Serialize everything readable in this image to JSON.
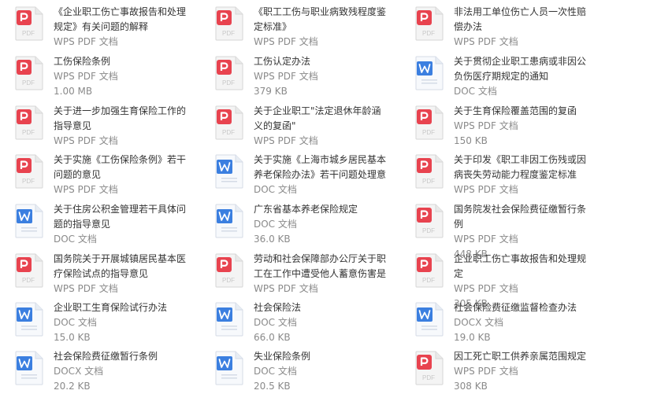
{
  "colors": {
    "pdf_red": "#e8434f",
    "doc_blue": "#3b7fe0",
    "meta_gray": "#8a8a8a",
    "text_dark": "#333333"
  },
  "files": [
    {
      "name": "《企业职工伤亡事故报告和处理规定》有关问题的解释",
      "type": "pdf",
      "type_label": "WPS PDF 文档",
      "size": ""
    },
    {
      "name": "《职工工伤与职业病致残程度鉴定标准》",
      "type": "pdf",
      "type_label": "WPS PDF 文档",
      "size": ""
    },
    {
      "name": "非法用工单位伤亡人员一次性赔偿办法",
      "type": "pdf",
      "type_label": "WPS PDF 文档",
      "size": ""
    },
    {
      "name": "工伤保险条例",
      "type": "pdf",
      "type_label": "WPS PDF 文档",
      "size": "1.00 MB"
    },
    {
      "name": "工伤认定办法",
      "type": "pdf",
      "type_label": "WPS PDF 文档",
      "size": "379 KB"
    },
    {
      "name": "关于贯彻企业职工患病或非因公负伤医疗期规定的通知",
      "type": "doc",
      "type_label": "DOC 文档",
      "size": ""
    },
    {
      "name": "关于进一步加强生育保险工作的指导意见",
      "type": "pdf",
      "type_label": "WPS PDF 文档",
      "size": ""
    },
    {
      "name": "关于企业职工\"法定退休年龄涵义的复函\"",
      "type": "pdf",
      "type_label": "WPS PDF 文档",
      "size": ""
    },
    {
      "name": "关于生育保险覆盖范围的复函",
      "type": "pdf",
      "type_label": "WPS PDF 文档",
      "size": "150 KB"
    },
    {
      "name": "关于实施《工伤保险条例》若干问题的意见",
      "type": "pdf",
      "type_label": "WPS PDF 文档",
      "size": ""
    },
    {
      "name": "关于实施《上海市城乡居民基本养老保险办法》若干问题处理意见...",
      "type": "doc",
      "type_label": "DOC 文档",
      "size": ""
    },
    {
      "name": "关于印发《职工非因工伤残或因病丧失劳动能力程度鉴定标准(试行)...",
      "type": "pdf",
      "type_label": "WPS PDF 文档",
      "size": ""
    },
    {
      "name": "关于住房公积金管理若干具体问题的指导意见",
      "type": "doc",
      "type_label": "DOC 文档",
      "size": ""
    },
    {
      "name": "广东省基本养老保险规定",
      "type": "doc",
      "type_label": "DOC 文档",
      "size": "36.0 KB"
    },
    {
      "name": "国务院发社会保险费征缴暂行条例",
      "type": "pdf",
      "type_label": "WPS PDF 文档",
      "size": "448 KB"
    },
    {
      "name": "国务院关于开展城镇居民基本医疗保险试点的指导意见",
      "type": "pdf",
      "type_label": "WPS PDF 文档",
      "size": ""
    },
    {
      "name": "劳动和社会保障部办公厅关于职工在工作中遭受他人蓄意伤害是否...",
      "type": "pdf",
      "type_label": "WPS PDF 文档",
      "size": ""
    },
    {
      "name": "企业职工伤亡事故报告和处理规定",
      "type": "pdf",
      "type_label": "WPS PDF 文档",
      "size": "305 KB"
    },
    {
      "name": "企业职工生育保险试行办法",
      "type": "doc",
      "type_label": "DOC 文档",
      "size": "15.0 KB"
    },
    {
      "name": "社会保险法",
      "type": "doc",
      "type_label": "DOC 文档",
      "size": "66.0 KB"
    },
    {
      "name": "社会保险费征缴监督检查办法",
      "type": "docx",
      "type_label": "DOCX 文档",
      "size": "19.0 KB"
    },
    {
      "name": "社会保险费征缴暂行条例",
      "type": "docx",
      "type_label": "DOCX 文档",
      "size": "20.2 KB"
    },
    {
      "name": "失业保险条例",
      "type": "doc",
      "type_label": "DOC 文档",
      "size": "20.5 KB"
    },
    {
      "name": "因工死亡职工供养亲属范围规定",
      "type": "pdf",
      "type_label": "WPS PDF 文档",
      "size": "308 KB"
    }
  ]
}
